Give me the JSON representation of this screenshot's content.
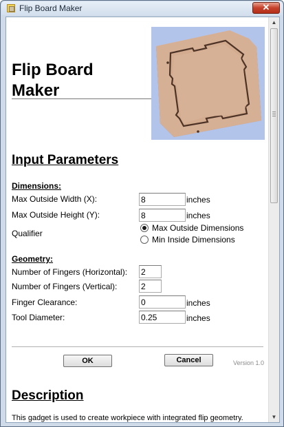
{
  "window": {
    "title": "Flip Board Maker",
    "close_glyph": "✕"
  },
  "header": {
    "title_line1": "Flip Board",
    "title_line2": "Maker",
    "preview_icon": "flip-board-3d-preview"
  },
  "input_parameters": {
    "title": "Input Parameters",
    "dimensions": {
      "title": "Dimensions:",
      "width_label": "Max Outside Width (X):",
      "width_value": "8",
      "width_unit": "inches",
      "height_label": "Max Outside Height (Y):",
      "height_value": "8",
      "height_unit": "inches",
      "qualifier_label": "Qualifier",
      "qualifier_options": [
        "Max Outside Dimensions",
        "Min Inside Dimensions"
      ],
      "qualifier_selected": "Max Outside Dimensions"
    },
    "geometry": {
      "title": "Geometry:",
      "fingers_h_label": "Number of Fingers (Horizontal):",
      "fingers_h_value": "2",
      "fingers_v_label": "Number of Fingers (Vertical):",
      "fingers_v_value": "2",
      "clearance_label": "Finger Clearance:",
      "clearance_value": "0",
      "clearance_unit": "inches",
      "tool_label": "Tool Diameter:",
      "tool_value": "0.25",
      "tool_unit": "inches"
    }
  },
  "actions": {
    "ok_label": "OK",
    "cancel_label": "Cancel",
    "version": "Version 1.0"
  },
  "description": {
    "title": "Description",
    "text": "This gadget is used to create workpiece with integrated flip geometry."
  },
  "scrollbar": {
    "up_glyph": "▲",
    "down_glyph": "▼"
  },
  "colors": {
    "titlebar": "#dce6f2",
    "close": "#c5412a",
    "preview_bg": "#b3c4eb",
    "wood": "#d9b59a"
  }
}
